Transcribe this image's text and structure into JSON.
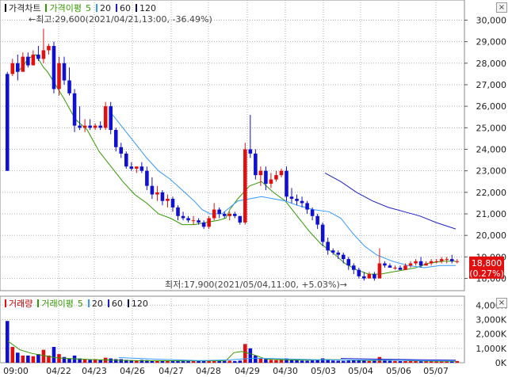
{
  "price_legend": {
    "main_label": "가격차트",
    "ma_label": "가격이평",
    "periods": [
      "5",
      "20",
      "60",
      "120"
    ],
    "colors": {
      "main": "#000000",
      "ma5": "#339900",
      "ma20": "#3399ff",
      "ma60": "#1f1fc8",
      "ma120": "#0a0a66"
    }
  },
  "volume_legend": {
    "main_label": "거래량",
    "ma_label": "거래이평",
    "periods": [
      "5",
      "20",
      "60",
      "120"
    ]
  },
  "controls": {
    "close_glyph": "×"
  },
  "annotations": {
    "high": "←최고:29,600(2021/04/21,13:00, -36.49%)",
    "low": "최저:17,900(2021/05/04,11:00, +5.03%)→"
  },
  "price_tag": {
    "value": "18,800",
    "change": "(0.27%)",
    "color": "#e01010"
  },
  "colors": {
    "up": "#e01010",
    "down": "#1010d0",
    "grid": "#b0b0b0"
  },
  "chart_data": {
    "type": "candlestick",
    "y_axis_ticks": [
      "30,000",
      "29,000",
      "28,000",
      "27,000",
      "26,000",
      "25,000",
      "24,000",
      "23,000",
      "22,000",
      "21,000",
      "20,000",
      "19,000",
      "18,000"
    ],
    "y_range": [
      17800,
      30200
    ],
    "volume_axis_ticks": [
      "4,000K",
      "3,000K",
      "2,000K",
      "1,000K",
      "0K"
    ],
    "volume_range": [
      0,
      4400
    ],
    "x_labels": [
      "09:00",
      "04/22",
      "04/23",
      "04/26",
      "04/27",
      "04/28",
      "04/29",
      "04/30",
      "05/03",
      "05/04",
      "05/06",
      "05/07"
    ],
    "candles": [
      [
        27500,
        27600,
        23000,
        23000
      ],
      [
        27500,
        28200,
        27400,
        28000
      ],
      [
        28000,
        28400,
        27200,
        27600
      ],
      [
        27600,
        28500,
        27700,
        28300
      ],
      [
        28300,
        28500,
        27800,
        27900
      ],
      [
        27900,
        28600,
        28000,
        28400
      ],
      [
        28400,
        28800,
        28100,
        28200
      ],
      [
        28200,
        29600,
        28000,
        28600
      ],
      [
        28600,
        28900,
        28400,
        28800
      ],
      [
        28800,
        29000,
        26600,
        26800
      ],
      [
        26800,
        28300,
        26500,
        28000
      ],
      [
        28000,
        28300,
        27000,
        27200
      ],
      [
        27200,
        27800,
        26500,
        26600
      ],
      [
        26600,
        26800,
        24800,
        25100
      ],
      [
        25100,
        26000,
        24900,
        25000
      ],
      [
        25000,
        25400,
        24800,
        25100
      ],
      [
        25100,
        25400,
        24900,
        25000
      ],
      [
        25000,
        25200,
        24900,
        25100
      ],
      [
        25100,
        25300,
        24900,
        25000
      ],
      [
        25000,
        26200,
        24900,
        26000
      ],
      [
        26000,
        26200,
        24700,
        24900
      ],
      [
        24900,
        25000,
        23900,
        24100
      ],
      [
        24100,
        24300,
        23600,
        23800
      ],
      [
        23800,
        23900,
        23100,
        23200
      ],
      [
        23200,
        23400,
        23000,
        23100
      ],
      [
        23100,
        23200,
        22900,
        23200
      ],
      [
        23200,
        23400,
        22900,
        23000
      ],
      [
        23000,
        23200,
        22100,
        22300
      ],
      [
        22300,
        22700,
        21700,
        21900
      ],
      [
        21900,
        22300,
        21600,
        22000
      ],
      [
        22000,
        22100,
        21400,
        21600
      ],
      [
        21600,
        21900,
        21300,
        21700
      ],
      [
        21700,
        21800,
        21100,
        21300
      ],
      [
        21300,
        21400,
        20700,
        20900
      ],
      [
        20900,
        21100,
        20700,
        20800
      ],
      [
        20800,
        20900,
        20600,
        20700
      ],
      [
        20700,
        20900,
        20500,
        20700
      ],
      [
        20700,
        20800,
        20500,
        20600
      ],
      [
        20600,
        20700,
        20300,
        20400
      ],
      [
        20400,
        20900,
        20300,
        20800
      ],
      [
        20800,
        21500,
        20700,
        21200
      ],
      [
        21200,
        21300,
        20800,
        21000
      ],
      [
        21000,
        21100,
        20800,
        20900
      ],
      [
        20900,
        21100,
        20700,
        21000
      ],
      [
        21000,
        21100,
        20800,
        20900
      ],
      [
        20900,
        20900,
        20500,
        20600
      ],
      [
        20600,
        24300,
        20500,
        24000
      ],
      [
        24000,
        25600,
        23600,
        23800
      ],
      [
        23800,
        24000,
        22600,
        22800
      ],
      [
        22800,
        23200,
        22300,
        23000
      ],
      [
        23000,
        23200,
        22100,
        22400
      ],
      [
        22400,
        22900,
        22200,
        22600
      ],
      [
        22600,
        23000,
        22500,
        22800
      ],
      [
        22800,
        23100,
        22700,
        23000
      ],
      [
        23000,
        23200,
        21600,
        21800
      ],
      [
        21800,
        22200,
        21500,
        21700
      ],
      [
        21700,
        21900,
        21400,
        21600
      ],
      [
        21600,
        21800,
        21300,
        21500
      ],
      [
        21500,
        21600,
        21000,
        21200
      ],
      [
        21200,
        21300,
        20700,
        20900
      ],
      [
        20900,
        21000,
        20300,
        20500
      ],
      [
        20500,
        20600,
        19500,
        19700
      ],
      [
        19700,
        19900,
        19100,
        19300
      ],
      [
        19300,
        19400,
        19100,
        19200
      ],
      [
        19200,
        19300,
        18900,
        19100
      ],
      [
        19100,
        19200,
        18700,
        18900
      ],
      [
        18900,
        19000,
        18400,
        18600
      ],
      [
        18600,
        18700,
        18200,
        18400
      ],
      [
        18400,
        18500,
        18000,
        18100
      ],
      [
        18100,
        18300,
        17900,
        18000
      ],
      [
        18000,
        18300,
        18000,
        18200
      ],
      [
        18200,
        18300,
        17900,
        18000
      ],
      [
        18000,
        19400,
        18000,
        18700
      ],
      [
        18700,
        18800,
        18500,
        18600
      ],
      [
        18600,
        18700,
        18500,
        18500
      ],
      [
        18500,
        18600,
        18400,
        18500
      ],
      [
        18500,
        18600,
        18400,
        18400
      ],
      [
        18400,
        18700,
        18400,
        18600
      ],
      [
        18600,
        18800,
        18500,
        18700
      ],
      [
        18700,
        18900,
        18600,
        18800
      ],
      [
        18800,
        19000,
        18500,
        18600
      ],
      [
        18600,
        18800,
        18600,
        18700
      ],
      [
        18700,
        18900,
        18600,
        18800
      ],
      [
        18800,
        18900,
        18700,
        18800
      ],
      [
        18800,
        19000,
        18700,
        18900
      ],
      [
        18900,
        19000,
        18700,
        18900
      ],
      [
        18900,
        19100,
        18700,
        18800
      ],
      [
        18800,
        18900,
        18700,
        18800
      ]
    ],
    "volumes": [
      2900,
      1100,
      700,
      500,
      500,
      450,
      600,
      900,
      500,
      1100,
      600,
      400,
      300,
      500,
      300,
      250,
      200,
      250,
      200,
      350,
      300,
      250,
      250,
      200,
      180,
      160,
      200,
      180,
      150,
      160,
      140,
      160,
      150,
      130,
      150,
      120,
      130,
      120,
      120,
      140,
      180,
      150,
      120,
      140,
      120,
      150,
      1300,
      1000,
      500,
      300,
      250,
      200,
      180,
      200,
      300,
      200,
      180,
      150,
      140,
      160,
      200,
      300,
      250,
      150,
      140,
      130,
      150,
      180,
      200,
      150,
      120,
      150,
      400,
      180,
      130,
      120,
      110,
      110,
      120,
      130,
      100,
      100,
      90,
      90,
      100,
      100,
      110,
      120
    ],
    "ma_price": [
      {
        "name": "5",
        "color": "#339900",
        "points": [
          [
            20,
            27600
          ],
          [
            25,
            27700
          ],
          [
            30,
            27900
          ],
          [
            35,
            28200
          ],
          [
            40,
            28300
          ],
          [
            45,
            28400
          ],
          [
            50,
            28100
          ],
          [
            55,
            27800
          ],
          [
            60,
            27600
          ],
          [
            65,
            27300
          ],
          [
            70,
            27000
          ],
          [
            80,
            26400
          ],
          [
            95,
            25400
          ],
          [
            110,
            24900
          ],
          [
            125,
            23900
          ],
          [
            140,
            23200
          ],
          [
            155,
            22500
          ],
          [
            170,
            21900
          ],
          [
            185,
            21500
          ],
          [
            200,
            21000
          ],
          [
            215,
            20800
          ],
          [
            230,
            20500
          ],
          [
            245,
            20500
          ],
          [
            260,
            20600
          ],
          [
            275,
            20700
          ],
          [
            285,
            20800
          ],
          [
            290,
            21200
          ],
          [
            300,
            21700
          ],
          [
            315,
            22300
          ],
          [
            330,
            22500
          ],
          [
            345,
            22000
          ],
          [
            360,
            21600
          ],
          [
            375,
            20900
          ],
          [
            390,
            20200
          ],
          [
            405,
            19600
          ],
          [
            420,
            19200
          ],
          [
            435,
            18700
          ],
          [
            450,
            18400
          ],
          [
            465,
            18200
          ],
          [
            480,
            18200
          ],
          [
            495,
            18300
          ],
          [
            510,
            18400
          ],
          [
            525,
            18500
          ],
          [
            540,
            18700
          ],
          [
            560,
            18800
          ],
          [
            575,
            18800
          ]
        ]
      },
      {
        "name": "20",
        "color": "#3399ff",
        "points": [
          [
            140,
            25700
          ],
          [
            155,
            25000
          ],
          [
            170,
            24300
          ],
          [
            185,
            23600
          ],
          [
            200,
            23000
          ],
          [
            215,
            22600
          ],
          [
            230,
            22100
          ],
          [
            245,
            21600
          ],
          [
            255,
            21200
          ],
          [
            265,
            21000
          ],
          [
            280,
            21000
          ],
          [
            290,
            21300
          ],
          [
            300,
            21600
          ],
          [
            315,
            21700
          ],
          [
            330,
            21800
          ],
          [
            345,
            21700
          ],
          [
            360,
            21600
          ],
          [
            375,
            21400
          ],
          [
            395,
            21200
          ],
          [
            415,
            21100
          ],
          [
            430,
            20800
          ],
          [
            445,
            20100
          ],
          [
            460,
            19500
          ],
          [
            475,
            19100
          ],
          [
            495,
            18800
          ],
          [
            515,
            18600
          ],
          [
            535,
            18500
          ],
          [
            555,
            18600
          ],
          [
            575,
            18600
          ]
        ]
      },
      {
        "name": "60",
        "color": "#1f1fc8",
        "points": [
          [
            410,
            22900
          ],
          [
            430,
            22500
          ],
          [
            450,
            22000
          ],
          [
            470,
            21600
          ],
          [
            490,
            21300
          ],
          [
            510,
            21100
          ],
          [
            530,
            20900
          ],
          [
            550,
            20600
          ],
          [
            575,
            20300
          ]
        ]
      }
    ],
    "ma_volume": [
      {
        "name": "5",
        "color": "#339900",
        "points": [
          [
            10,
            1500
          ],
          [
            25,
            900
          ],
          [
            40,
            650
          ],
          [
            55,
            500
          ],
          [
            70,
            350
          ],
          [
            90,
            280
          ],
          [
            110,
            230
          ],
          [
            130,
            200
          ],
          [
            150,
            170
          ],
          [
            170,
            150
          ],
          [
            190,
            140
          ],
          [
            210,
            135
          ],
          [
            230,
            130
          ],
          [
            250,
            130
          ],
          [
            270,
            130
          ],
          [
            285,
            140
          ],
          [
            295,
            700
          ],
          [
            305,
            780
          ],
          [
            320,
            560
          ],
          [
            335,
            260
          ],
          [
            350,
            220
          ],
          [
            370,
            190
          ],
          [
            390,
            180
          ],
          [
            410,
            220
          ],
          [
            430,
            210
          ],
          [
            450,
            170
          ],
          [
            470,
            150
          ],
          [
            490,
            180
          ],
          [
            510,
            160
          ],
          [
            530,
            120
          ],
          [
            550,
            105
          ],
          [
            575,
            100
          ]
        ]
      },
      {
        "name": "20",
        "color": "#3399ff",
        "points": [
          [
            150,
            360
          ],
          [
            200,
            240
          ],
          [
            250,
            150
          ],
          [
            290,
            200
          ],
          [
            320,
            320
          ],
          [
            360,
            270
          ],
          [
            400,
            210
          ],
          [
            450,
            190
          ],
          [
            500,
            170
          ],
          [
            550,
            130
          ],
          [
            575,
            120
          ]
        ]
      },
      {
        "name": "60",
        "color": "#1f1fc8",
        "points": [
          [
            430,
            300
          ],
          [
            480,
            250
          ],
          [
            530,
            210
          ],
          [
            575,
            180
          ]
        ]
      }
    ]
  }
}
